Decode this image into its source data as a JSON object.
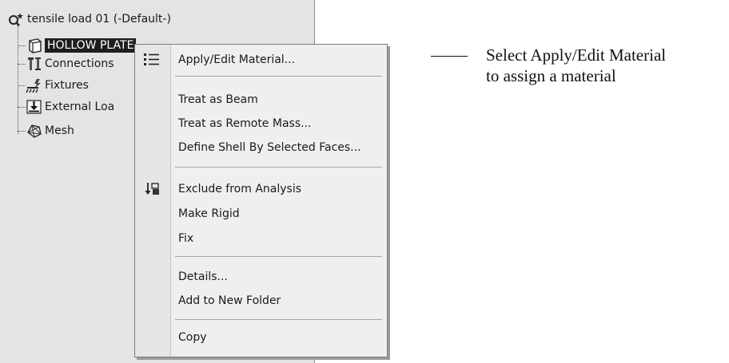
{
  "tree": {
    "root": {
      "label": "tensile load 01 (-Default-)",
      "icon": "study-icon"
    },
    "items": [
      {
        "label": "HOLLOW PLATE",
        "icon": "part-icon",
        "selected": true
      },
      {
        "label": "Connections",
        "icon": "connections-icon"
      },
      {
        "label": "Fixtures",
        "icon": "fixtures-icon"
      },
      {
        "label": "External Loa",
        "icon": "external-loads-icon"
      },
      {
        "label": "Mesh",
        "icon": "mesh-icon"
      }
    ]
  },
  "menu": {
    "items": [
      {
        "label": "Apply/Edit Material...",
        "icon": "material-list-icon"
      },
      {
        "label": "Treat as Beam"
      },
      {
        "label": "Treat as Remote Mass..."
      },
      {
        "label": "Define Shell By Selected Faces..."
      },
      {
        "label": "Exclude from Analysis",
        "icon": "exclude-icon"
      },
      {
        "label": "Make Rigid"
      },
      {
        "label": "Fix"
      },
      {
        "label": "Details..."
      },
      {
        "label": "Add to New Folder"
      },
      {
        "label": "Copy"
      }
    ]
  },
  "callout": {
    "line1": "Select Apply/Edit Material",
    "line2": "to assign a material"
  }
}
